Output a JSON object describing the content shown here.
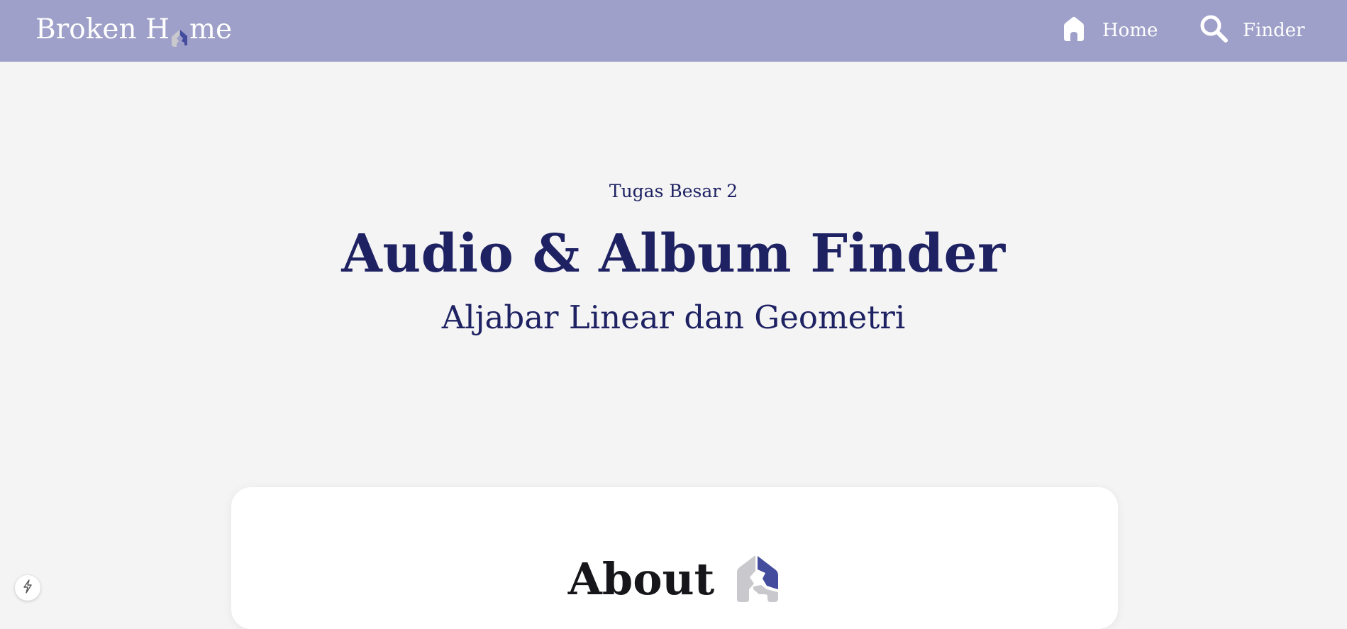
{
  "navbar": {
    "brand_prefix": "Broken H",
    "brand_suffix": "me",
    "home_label": "Home",
    "finder_label": "Finder",
    "home_icon": "house-icon",
    "finder_icon": "magnifier-icon"
  },
  "hero": {
    "kicker": "Tugas Besar 2",
    "title": "Audio & Album Finder",
    "subtitle": "Aljabar Linear dan Geometri"
  },
  "about": {
    "title": "About",
    "icon": "broken-house-icon"
  },
  "floating_button": {
    "icon": "lightning-bolt-icon"
  },
  "colors": {
    "navbar_bg": "#9ea0c9",
    "hero_text": "#1e2262",
    "page_bg": "#f4f4f5",
    "accent": "#444c9e",
    "house_grey": "#c9c9cd"
  }
}
